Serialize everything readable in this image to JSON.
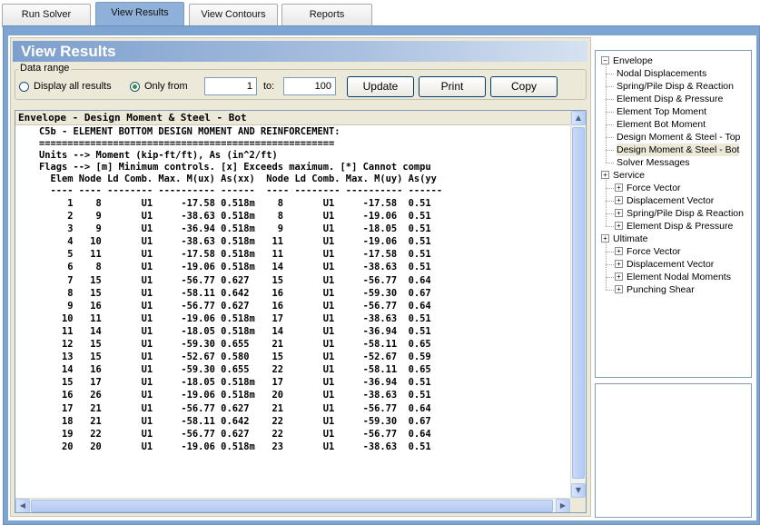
{
  "tabs": [
    {
      "label": "Run Solver"
    },
    {
      "label": "View Results"
    },
    {
      "label": "View Contours"
    },
    {
      "label": "Reports"
    }
  ],
  "panel": {
    "title": "View Results",
    "data_range_legend": "Data range",
    "radio_all_label": "Display all results",
    "radio_from_label": "Only from",
    "from_value": "1",
    "to_label": "to:",
    "to_value": "100",
    "update_label": "Update",
    "print_label": "Print",
    "copy_label": "Copy"
  },
  "results": {
    "title": "Envelope - Design Moment & Steel - Bot",
    "header_lines": [
      "C5b - ELEMENT BOTTOM DESIGN MOMENT AND REINFORCEMENT:",
      "====================================================",
      "Units --> Moment (kip-ft/ft), As (in^2/ft)",
      "Flags --> [m] Minimum controls. [x] Exceeds maximum. [*] Cannot compu",
      "  Elem Node Ld Comb. Max. M(ux) As(xx)  Node Ld Comb. Max. M(uy) As(yy",
      "  ---- ---- -------- ---------- ------  ---- -------- ---------- ------"
    ],
    "rows": [
      "     1    8       U1     -17.58 0.518m    8       U1     -17.58  0.51",
      "     2    9       U1     -38.63 0.518m    8       U1     -19.06  0.51",
      "     3    9       U1     -36.94 0.518m    9       U1     -18.05  0.51",
      "     4   10       U1     -38.63 0.518m   11       U1     -19.06  0.51",
      "     5   11       U1     -17.58 0.518m   11       U1     -17.58  0.51",
      "     6    8       U1     -19.06 0.518m   14       U1     -38.63  0.51",
      "     7   15       U1     -56.77 0.627    15       U1     -56.77  0.64",
      "     8   15       U1     -58.11 0.642    16       U1     -59.30  0.67",
      "     9   16       U1     -56.77 0.627    16       U1     -56.77  0.64",
      "    10   11       U1     -19.06 0.518m   17       U1     -38.63  0.51",
      "    11   14       U1     -18.05 0.518m   14       U1     -36.94  0.51",
      "    12   15       U1     -59.30 0.655    21       U1     -58.11  0.65",
      "    13   15       U1     -52.67 0.580    15       U1     -52.67  0.59",
      "    14   16       U1     -59.30 0.655    22       U1     -58.11  0.65",
      "    15   17       U1     -18.05 0.518m   17       U1     -36.94  0.51",
      "    16   26       U1     -19.06 0.518m   20       U1     -38.63  0.51",
      "    17   21       U1     -56.77 0.627    21       U1     -56.77  0.64",
      "    18   21       U1     -58.11 0.642    22       U1     -59.30  0.67",
      "    19   22       U1     -56.77 0.627    22       U1     -56.77  0.64",
      "    20   20       U1     -19.06 0.518m   23       U1     -38.63  0.51"
    ]
  },
  "tree": {
    "envelope": "Envelope",
    "envelope_items": [
      "Nodal Displacements",
      "Spring/Pile Disp & Reaction",
      "Element Disp & Pressure",
      "Element Top Moment",
      "Element Bot Moment",
      "Design Moment & Steel - Top",
      "Design Moment & Steel - Bot",
      "Solver Messages"
    ],
    "service": "Service",
    "service_items": [
      "Force Vector",
      "Displacement Vector",
      "Spring/Pile Disp & Reaction",
      "Element Disp & Pressure"
    ],
    "ultimate": "Ultimate",
    "ultimate_items": [
      "Force Vector",
      "Displacement Vector",
      "Element Nodal Moments",
      "Punching Shear"
    ],
    "expand_glyph": "+",
    "collapse_glyph": "−"
  },
  "scroll": {
    "up": "▲",
    "down": "▼",
    "left": "◀",
    "right": "▶"
  }
}
